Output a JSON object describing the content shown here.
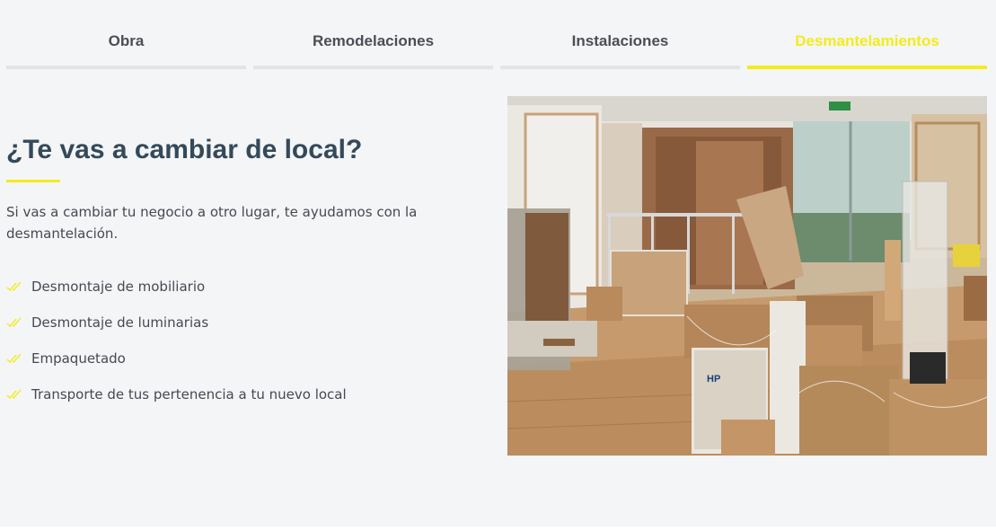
{
  "tabs": [
    {
      "label": "Obra",
      "active": false
    },
    {
      "label": "Remodelaciones",
      "active": false
    },
    {
      "label": "Instalaciones",
      "active": false
    },
    {
      "label": "Desmantelamientos",
      "active": true
    }
  ],
  "section": {
    "heading": "¿Te vas a cambiar de local?",
    "intro": "Si vas a cambiar tu negocio a otro lugar, te ayudamos con la desmantelación.",
    "features": [
      {
        "text": "Desmontaje de mobiliario",
        "icon": "double-check-icon"
      },
      {
        "text": "Desmontaje de luminarias",
        "icon": "double-check-icon"
      },
      {
        "text": "Empaquetado",
        "icon": "double-check-icon"
      },
      {
        "text": "Transporte de tus pertenencia a tu nuevo local",
        "icon": "double-check-icon"
      }
    ]
  },
  "photo": {
    "box_label": "HP"
  },
  "colors": {
    "accent": "#f2ec1c",
    "heading": "#34495a",
    "text": "#444a52",
    "tab_inactive": "#4a4e55",
    "background": "#f4f5f7"
  }
}
